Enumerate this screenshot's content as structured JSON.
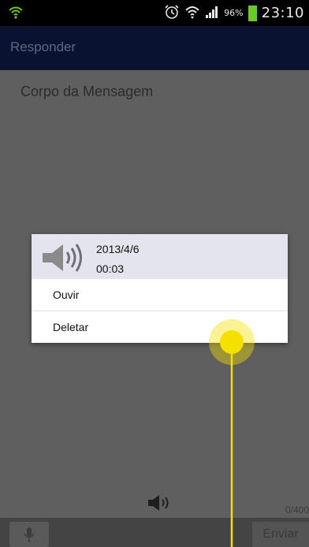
{
  "status_bar": {
    "battery_percent": "96%",
    "time": "23:10",
    "icons": [
      "wifi-shield-icon",
      "alarm-icon",
      "wifi-icon",
      "signal-icon",
      "battery-icon"
    ]
  },
  "action_bar": {
    "title": "Responder"
  },
  "compose": {
    "body_placeholder": "Corpo da Mensagem",
    "char_counter": "0/400",
    "send_label": "Enviar",
    "mic_icon": "mic-icon",
    "speaker_icon": "speaker-icon"
  },
  "dialog": {
    "date": "2013/4/6",
    "duration": "00:03",
    "items": [
      {
        "label": "Ouvir"
      },
      {
        "label": "Deletar"
      }
    ]
  },
  "colors": {
    "action_bar": "#0a1232",
    "content_bg": "#5f5f5f",
    "dialog_header": "#e4e4ee",
    "touch_indicator": "#f5e000",
    "battery": "#6acb26"
  }
}
